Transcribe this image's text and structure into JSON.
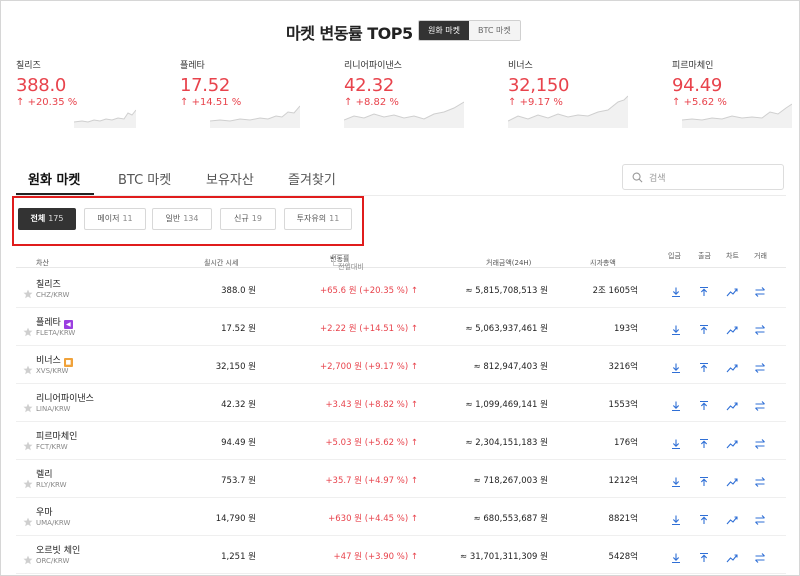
{
  "header": {
    "title": "마켓 변동률 TOP5",
    "toggle": [
      "원화 마켓",
      "BTC 마켓"
    ]
  },
  "top5": [
    {
      "name": "칠리즈",
      "price": "388.0",
      "rate": "+20.35 %"
    },
    {
      "name": "플레타",
      "price": "17.52",
      "rate": "+14.51 %"
    },
    {
      "name": "리니어파이낸스",
      "price": "42.32",
      "rate": "+8.82 %"
    },
    {
      "name": "비너스",
      "price": "32,150",
      "rate": "+9.17 %"
    },
    {
      "name": "피르마체인",
      "price": "94.49",
      "rate": "+5.62 %"
    }
  ],
  "tabs": [
    "원화 마켓",
    "BTC 마켓",
    "보유자산",
    "즐겨찾기"
  ],
  "search": {
    "placeholder": "검색"
  },
  "filters": [
    {
      "label": "전체",
      "count": "175"
    },
    {
      "label": "메이저",
      "count": "11"
    },
    {
      "label": "일반",
      "count": "134"
    },
    {
      "label": "신규",
      "count": "19"
    },
    {
      "label": "투자유의",
      "count": "11"
    }
  ],
  "columns": {
    "asset": "자산",
    "price": "실시간 시세",
    "change": "변동률",
    "change_select": "전일대비",
    "volume": "거래금액(24H)",
    "cap": "시가총액",
    "deposit": "입금",
    "withdraw": "출금",
    "chart": "차트",
    "trade": "거래"
  },
  "rows": [
    {
      "name": "칠리즈",
      "symbol": "CHZ/KRW",
      "price": "388.0 원",
      "change": "+65.6 원 (+20.35 %)",
      "volume": "≈ 5,815,708,513 원",
      "cap": "2조 1605억",
      "badge": ""
    },
    {
      "name": "플레타",
      "symbol": "FLETA/KRW",
      "price": "17.52 원",
      "change": "+2.22 원 (+14.51 %)",
      "volume": "≈ 5,063,937,461 원",
      "cap": "193억",
      "badge": "purple"
    },
    {
      "name": "비너스",
      "symbol": "XVS/KRW",
      "price": "32,150 원",
      "change": "+2,700 원 (+9.17 %)",
      "volume": "≈ 812,947,403 원",
      "cap": "3216억",
      "badge": "orange"
    },
    {
      "name": "리니어파이낸스",
      "symbol": "LINA/KRW",
      "price": "42.32 원",
      "change": "+3.43 원 (+8.82 %)",
      "volume": "≈ 1,099,469,141 원",
      "cap": "1553억",
      "badge": ""
    },
    {
      "name": "피르마체인",
      "symbol": "FCT/KRW",
      "price": "94.49 원",
      "change": "+5.03 원 (+5.62 %)",
      "volume": "≈ 2,304,151,183 원",
      "cap": "176억",
      "badge": ""
    },
    {
      "name": "렐리",
      "symbol": "RLY/KRW",
      "price": "753.7 원",
      "change": "+35.7 원 (+4.97 %)",
      "volume": "≈ 718,267,003 원",
      "cap": "1212억",
      "badge": ""
    },
    {
      "name": "우마",
      "symbol": "UMA/KRW",
      "price": "14,790 원",
      "change": "+630 원 (+4.45 %)",
      "volume": "≈ 680,553,687 원",
      "cap": "8821억",
      "badge": ""
    },
    {
      "name": "오르빗 체인",
      "symbol": "ORC/KRW",
      "price": "1,251 원",
      "change": "+47 원 (+3.90 %)",
      "volume": "≈ 31,701,311,309 원",
      "cap": "5428억",
      "badge": ""
    }
  ],
  "colors": {
    "up": "#e8434c",
    "accent": "#2f6fd6",
    "highlight": "#e01c1c"
  }
}
